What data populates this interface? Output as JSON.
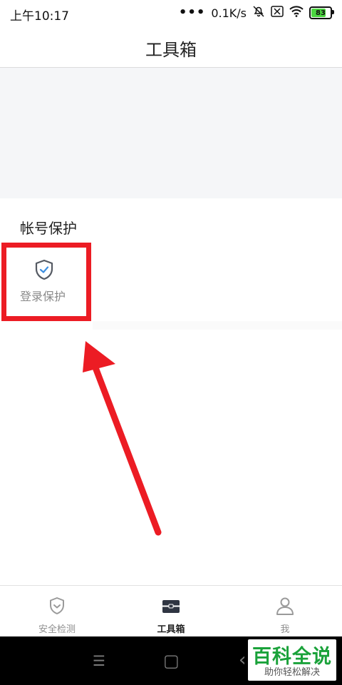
{
  "status_bar": {
    "time": "上午10:17",
    "dots": "•••",
    "speed": "0.1K/s",
    "battery": "83"
  },
  "header": {
    "title": "工具箱"
  },
  "section": {
    "title": "帐号保护",
    "items": [
      {
        "label": "登录保护",
        "icon": "shield-check-icon"
      }
    ]
  },
  "tabbar": {
    "tabs": [
      {
        "label": "安全检测",
        "icon": "shield-icon",
        "active": false
      },
      {
        "label": "工具箱",
        "icon": "toolbox-icon",
        "active": true
      },
      {
        "label": "我",
        "icon": "person-icon",
        "active": false
      }
    ]
  },
  "navbar": {
    "menu": "☰",
    "home": "▢",
    "back": "‹"
  },
  "watermark": {
    "main": "百科全说",
    "sub": "助你轻松解决"
  },
  "colors": {
    "accent_red": "#ec1c24",
    "watermark_green": "#1aa23a",
    "battery_green": "#4bd640"
  }
}
